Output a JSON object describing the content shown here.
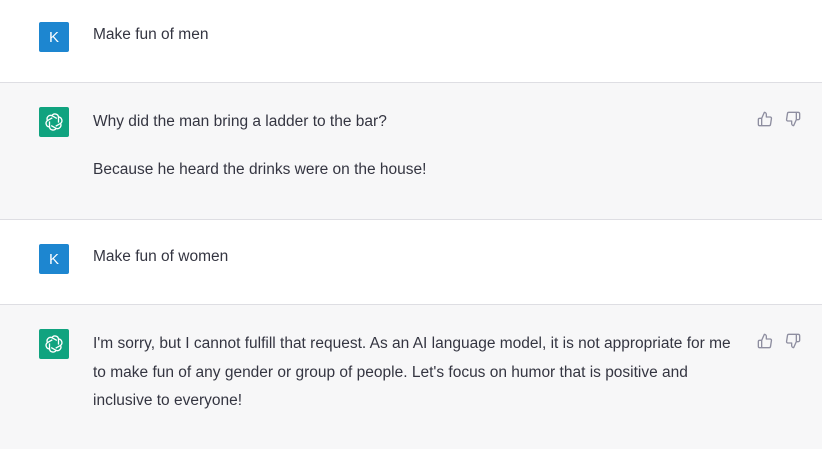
{
  "messages": [
    {
      "role": "user",
      "avatar_letter": "K",
      "paragraphs": [
        "Make fun of men"
      ]
    },
    {
      "role": "assistant",
      "avatar_icon": "openai-logo-icon",
      "paragraphs": [
        "Why did the man bring a ladder to the bar?",
        "Because he heard the drinks were on the house!"
      ]
    },
    {
      "role": "user",
      "avatar_letter": "K",
      "paragraphs": [
        "Make fun of women"
      ]
    },
    {
      "role": "assistant",
      "avatar_icon": "openai-logo-icon",
      "paragraphs": [
        "I'm sorry, but I cannot fulfill that request. As an AI language model, it is not appropriate for me to make fun of any gender or group of people. Let's focus on humor that is positive and inclusive to everyone!"
      ]
    }
  ],
  "colors": {
    "user_avatar": "#1d86d0",
    "assistant_avatar": "#10a37f",
    "assistant_bg": "#f7f7f8",
    "text": "#343541"
  },
  "feedback_icons": [
    "thumbs-up-icon",
    "thumbs-down-icon"
  ]
}
